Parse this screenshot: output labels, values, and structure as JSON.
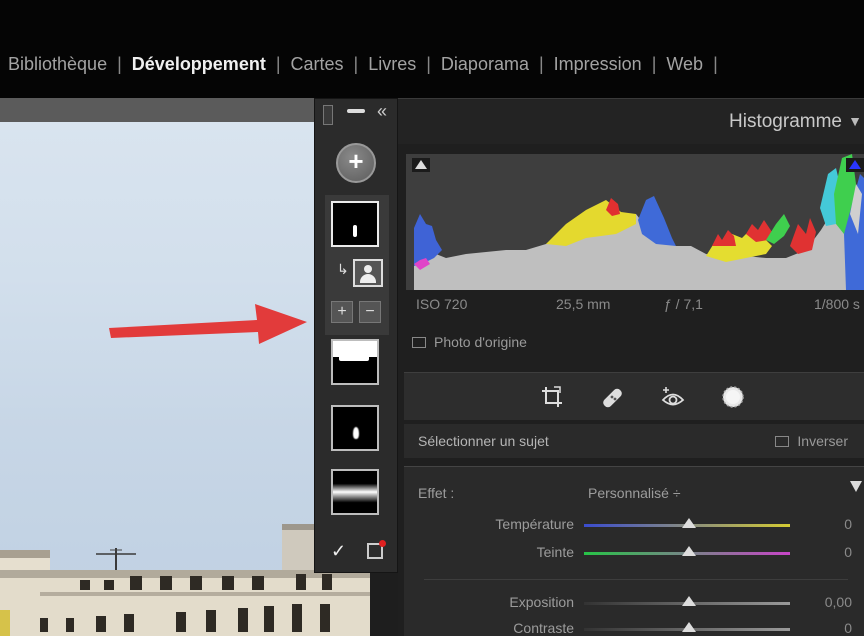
{
  "modules": [
    {
      "label": "Bibliothèque",
      "active": false
    },
    {
      "label": "Développement",
      "active": true
    },
    {
      "label": "Cartes",
      "active": false
    },
    {
      "label": "Livres",
      "active": false
    },
    {
      "label": "Diaporama",
      "active": false
    },
    {
      "label": "Impression",
      "active": false
    },
    {
      "label": "Web",
      "active": false
    }
  ],
  "separator": "|",
  "mask_panel": {
    "collapse_glyph": "«",
    "add_glyph": "+",
    "add_sub_glyph": "+",
    "remove_sub_glyph": "−",
    "show_overlay_check": "✓",
    "masks": [
      "subject-mask",
      "sky-mask",
      "flame-mask",
      "gradient-mask"
    ]
  },
  "histogram": {
    "title": "Histogramme",
    "chevron": "▼",
    "iso": "ISO 720",
    "focal": "25,5 mm",
    "aperture": "ƒ / 7,1",
    "shutter": "1/800 s",
    "original_label": "Photo d'origine",
    "highlight_clip_color": "#2a36ff"
  },
  "tools": [
    "crop-icon",
    "healing-icon",
    "red-eye-icon",
    "masking-icon"
  ],
  "subject": {
    "label": "Sélectionner un sujet",
    "invert_label": "Inverser"
  },
  "effect": {
    "label": "Effet :",
    "value": "Personnalisé ÷",
    "sliders": [
      {
        "name": "Température",
        "value": "0",
        "colors": [
          "#3a4ccf",
          "#d4cb33"
        ]
      },
      {
        "name": "Teinte",
        "value": "0",
        "colors": [
          "#27c447",
          "#c845c8"
        ]
      },
      {
        "name": "Exposition",
        "value": "0,00",
        "colors": [
          "#333333",
          "#9a9a9a"
        ]
      },
      {
        "name": "Contraste",
        "value": "0",
        "colors": [
          "#333333",
          "#9a9a9a"
        ]
      }
    ]
  }
}
